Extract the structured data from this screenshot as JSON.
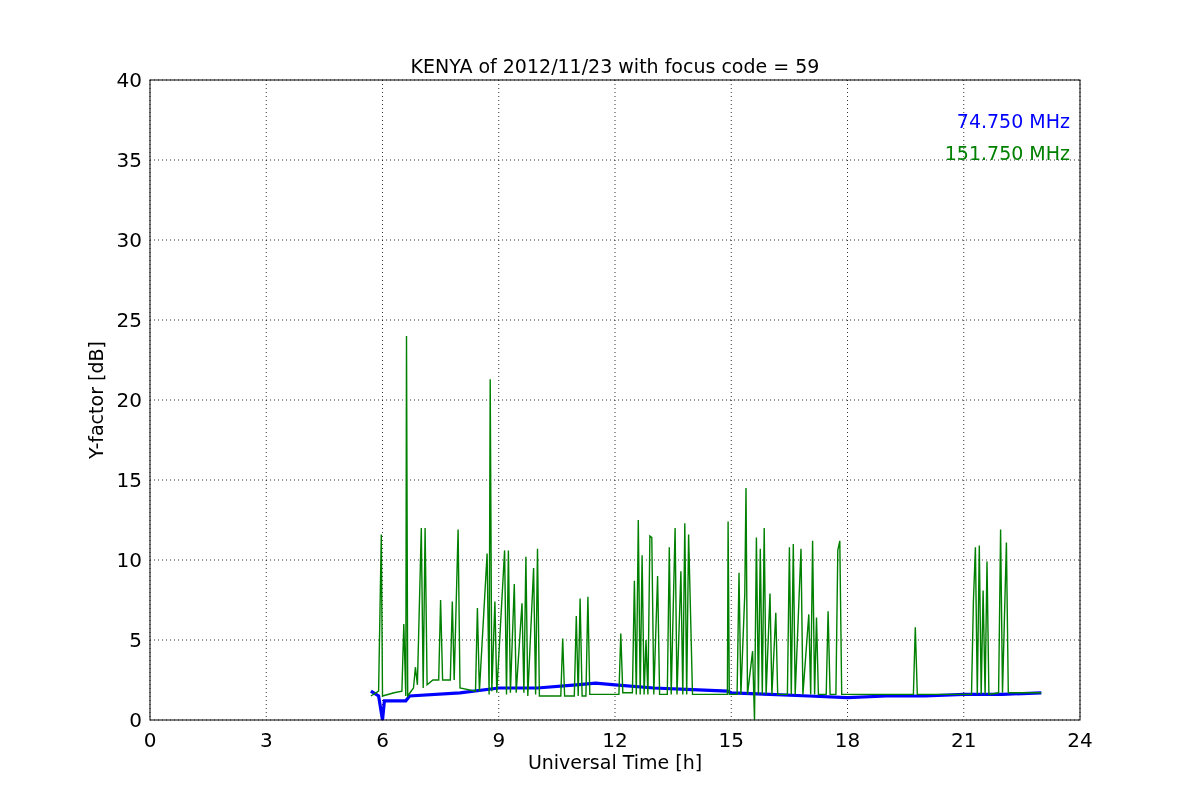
{
  "chart_data": {
    "type": "line",
    "title": "KENYA of 2012/11/23 with focus code = 59",
    "xlabel": "Universal Time [h]",
    "ylabel": "Y-factor [dB]",
    "grid": true,
    "xlim": [
      0,
      24
    ],
    "ylim": [
      0,
      40
    ],
    "xticks": [
      0,
      3,
      6,
      9,
      12,
      15,
      18,
      21,
      24
    ],
    "yticks": [
      0,
      5,
      10,
      15,
      20,
      25,
      30,
      35,
      40
    ],
    "series": [
      {
        "name": "74.750 MHz",
        "color": "#0000ff",
        "x": [
          5.7,
          5.9,
          6.0,
          6.05,
          6.6,
          6.7,
          8,
          9,
          10,
          11,
          11.5,
          12,
          13,
          14,
          14.9,
          15,
          16,
          17,
          18,
          19,
          20,
          21,
          22,
          23
        ],
        "values": [
          1.8,
          1.5,
          0.0,
          1.2,
          1.2,
          1.5,
          1.7,
          2.0,
          2.0,
          2.2,
          2.3,
          2.2,
          2.0,
          1.9,
          1.8,
          1.7,
          1.6,
          1.5,
          1.4,
          1.5,
          1.5,
          1.6,
          1.6,
          1.7
        ]
      },
      {
        "name": "151.750 MHz",
        "color": "#008000",
        "x": [
          5.7,
          5.9,
          5.97,
          6.0,
          6.3,
          6.5,
          6.55,
          6.6,
          6.62,
          6.65,
          6.8,
          6.85,
          6.9,
          7.0,
          7.05,
          7.1,
          7.15,
          7.3,
          7.45,
          7.5,
          7.55,
          7.75,
          7.8,
          7.85,
          7.95,
          8.0,
          8.4,
          8.45,
          8.5,
          8.7,
          8.75,
          8.78,
          8.82,
          8.9,
          8.95,
          9.15,
          9.2,
          9.25,
          9.3,
          9.4,
          9.45,
          9.6,
          9.65,
          9.7,
          9.75,
          9.9,
          9.95,
          10.0,
          10.05,
          10.6,
          10.65,
          10.7,
          10.95,
          11.0,
          11.05,
          11.1,
          11.15,
          11.25,
          11.3,
          11.35,
          12.1,
          12.15,
          12.2,
          12.45,
          12.5,
          12.55,
          12.6,
          12.65,
          12.7,
          12.75,
          12.8,
          12.85,
          12.9,
          12.95,
          13.0,
          13.1,
          13.15,
          13.35,
          13.4,
          13.45,
          13.55,
          13.6,
          13.7,
          13.75,
          13.8,
          13.85,
          13.9,
          13.95,
          14.0,
          14.9,
          14.92,
          14.95,
          15.15,
          15.2,
          15.25,
          15.35,
          15.38,
          15.42,
          15.55,
          15.6,
          15.65,
          15.7,
          15.75,
          15.8,
          15.85,
          15.9,
          16.0,
          16.05,
          16.15,
          16.2,
          16.45,
          16.5,
          16.55,
          16.6,
          16.65,
          16.8,
          16.85,
          17.0,
          17.05,
          17.1,
          17.15,
          17.2,
          17.25,
          17.45,
          17.5,
          17.55,
          17.7,
          17.75,
          17.8,
          17.85,
          19.7,
          19.75,
          19.8,
          21.2,
          21.25,
          21.3,
          21.35,
          21.4,
          21.45,
          21.5,
          21.55,
          21.6,
          21.65,
          21.9,
          21.95,
          22.0,
          22.1,
          22.15,
          23.0
        ],
        "values": [
          1.5,
          1.8,
          11.6,
          1.5,
          1.7,
          1.8,
          6.0,
          1.5,
          24.0,
          1.5,
          2.0,
          3.3,
          2.2,
          12.0,
          2.0,
          12.0,
          2.2,
          2.5,
          2.5,
          7.5,
          2.5,
          2.5,
          7.4,
          2.5,
          11.9,
          2.0,
          1.8,
          7.0,
          1.8,
          10.4,
          1.6,
          21.3,
          1.8,
          7.4,
          1.7,
          10.6,
          1.6,
          10.6,
          1.7,
          8.5,
          1.7,
          7.3,
          1.7,
          10.2,
          1.5,
          9.5,
          1.6,
          10.7,
          1.5,
          1.5,
          5.1,
          1.5,
          1.5,
          6.5,
          1.5,
          7.6,
          1.5,
          1.5,
          7.7,
          1.6,
          1.6,
          5.4,
          1.7,
          1.7,
          8.7,
          1.6,
          12.5,
          1.6,
          10.3,
          1.6,
          5.0,
          1.6,
          11.5,
          11.4,
          1.6,
          9.0,
          1.6,
          1.6,
          10.8,
          1.6,
          12.0,
          1.6,
          9.3,
          1.6,
          12.3,
          1.6,
          11.6,
          6.5,
          1.6,
          1.6,
          12.4,
          1.6,
          1.6,
          9.2,
          1.6,
          7.9,
          14.5,
          1.6,
          4.3,
          0.0,
          11.4,
          1.6,
          10.7,
          1.6,
          12.0,
          1.6,
          7.9,
          1.6,
          6.7,
          1.6,
          1.6,
          10.8,
          1.6,
          11.0,
          1.6,
          10.7,
          1.6,
          6.6,
          1.6,
          11.2,
          1.6,
          6.4,
          1.6,
          1.6,
          6.8,
          1.6,
          1.6,
          10.6,
          11.2,
          1.6,
          1.6,
          5.8,
          1.6,
          1.6,
          7.4,
          10.8,
          1.6,
          10.9,
          1.6,
          8.1,
          1.6,
          9.9,
          1.6,
          1.7,
          11.9,
          1.7,
          11.1,
          1.7,
          1.7
        ]
      }
    ]
  }
}
